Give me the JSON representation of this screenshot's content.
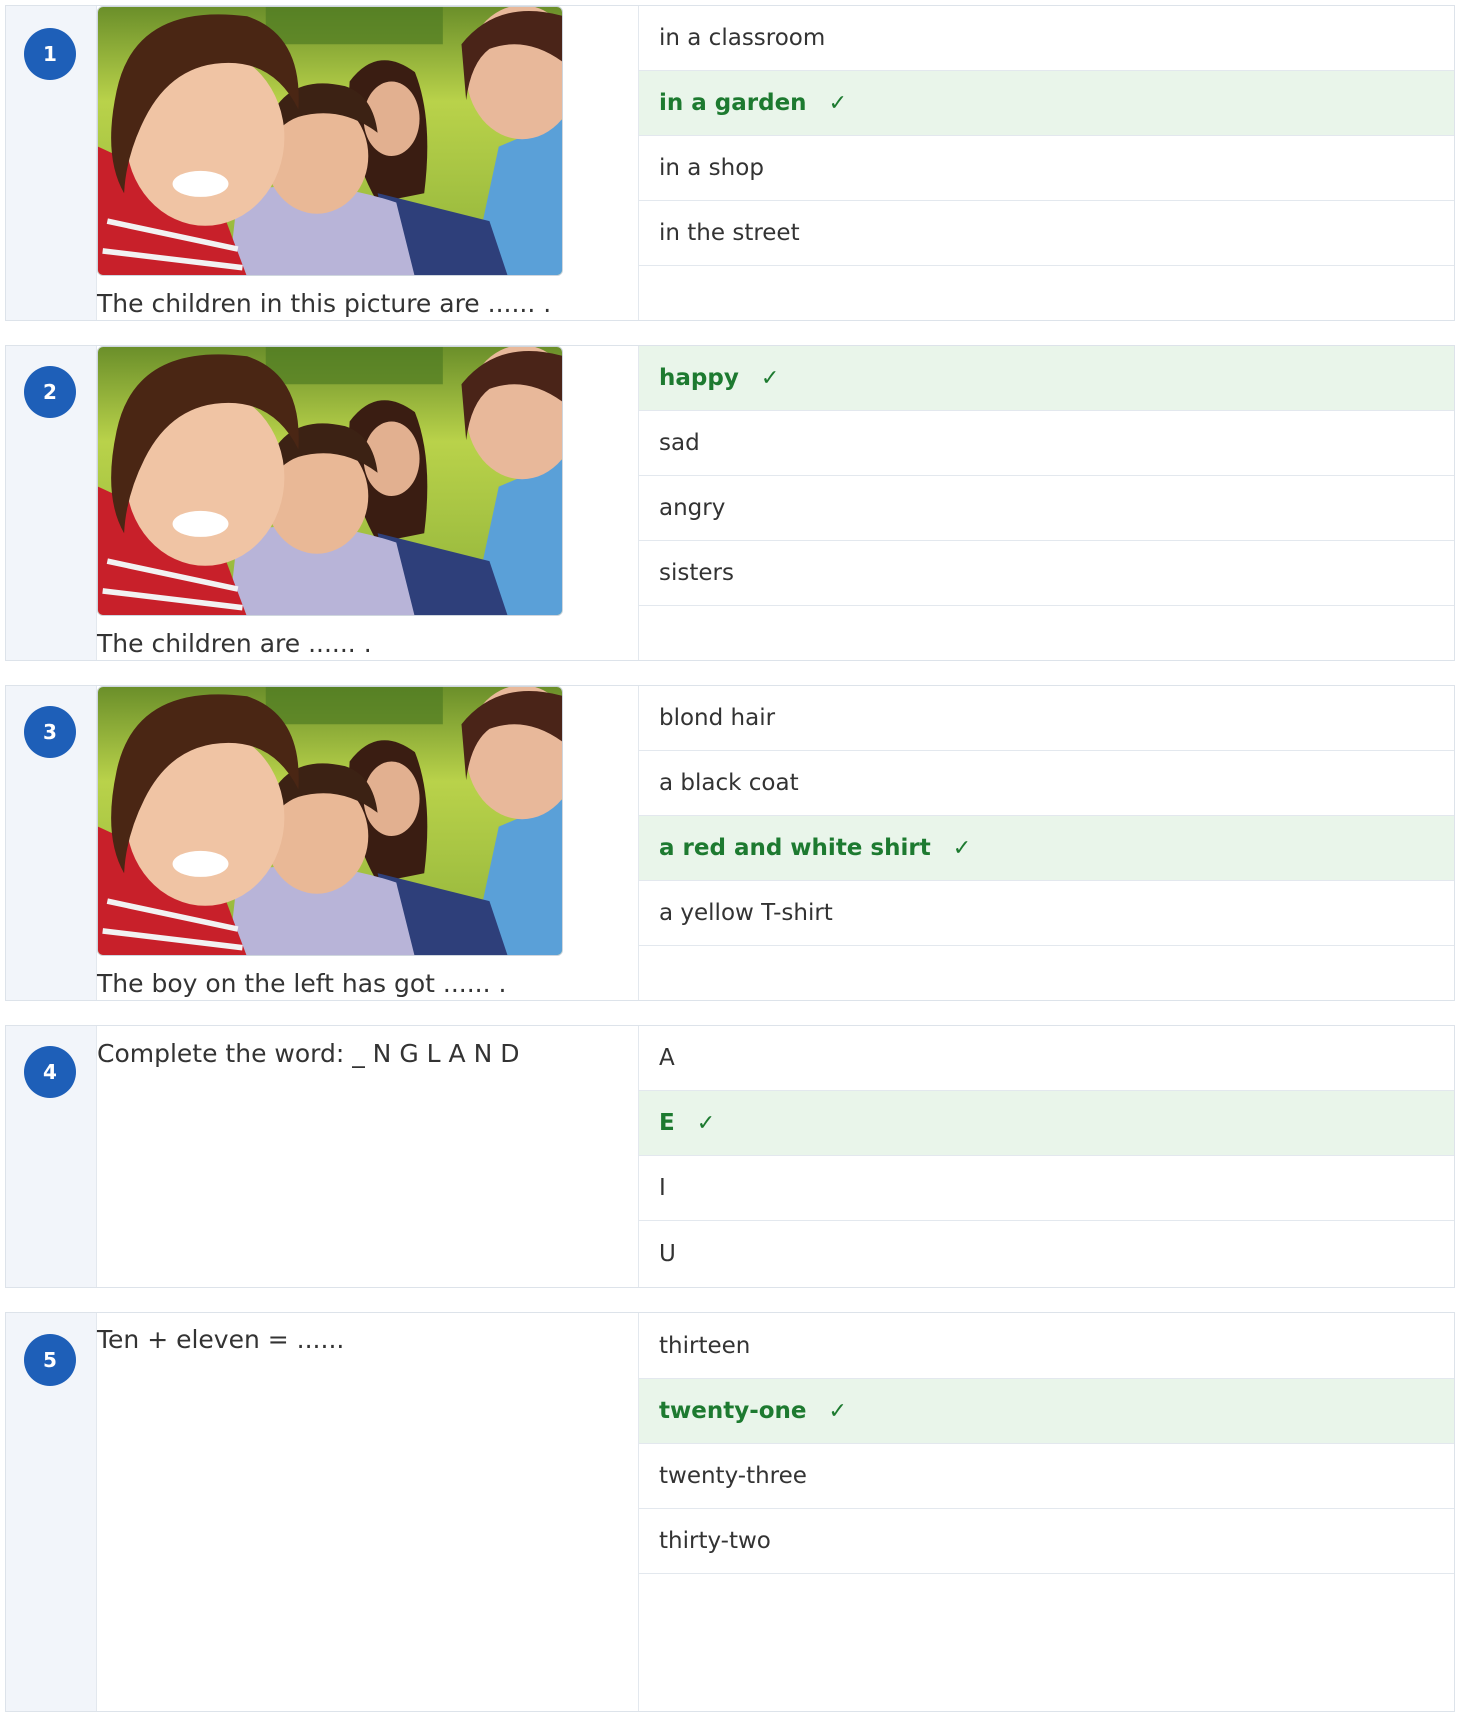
{
  "colors": {
    "badge": "#1e5fb8",
    "correct_bg": "#e9f5ea",
    "correct_text": "#1d7a30"
  },
  "check_mark": "✓",
  "questions": [
    {
      "number": "1",
      "image": "children-photo",
      "caption": "The children in this picture are ...... .",
      "options": [
        {
          "label": "in a classroom",
          "correct": false
        },
        {
          "label": "in a garden",
          "correct": true
        },
        {
          "label": "in a shop",
          "correct": false
        },
        {
          "label": "in the street",
          "correct": false
        }
      ]
    },
    {
      "number": "2",
      "image": "children-photo",
      "caption": "The children are ...... .",
      "options": [
        {
          "label": "happy",
          "correct": true
        },
        {
          "label": "sad",
          "correct": false
        },
        {
          "label": "angry",
          "correct": false
        },
        {
          "label": "sisters",
          "correct": false
        }
      ]
    },
    {
      "number": "3",
      "image": "children-photo",
      "caption": "The boy on the left has got ...... .",
      "options": [
        {
          "label": "blond hair",
          "correct": false
        },
        {
          "label": "a black coat",
          "correct": false
        },
        {
          "label": "a red and white shirt",
          "correct": true
        },
        {
          "label": "a yellow T-shirt",
          "correct": false
        }
      ]
    },
    {
      "number": "4",
      "text": "Complete the word: _ N G L A N D",
      "options": [
        {
          "label": "A",
          "correct": false
        },
        {
          "label": "E",
          "correct": true
        },
        {
          "label": "I",
          "correct": false
        },
        {
          "label": "U",
          "correct": false
        }
      ]
    },
    {
      "number": "5",
      "text": "Ten + eleven = ......",
      "options": [
        {
          "label": "thirteen",
          "correct": false
        },
        {
          "label": "twenty-one",
          "correct": true
        },
        {
          "label": "twenty-three",
          "correct": false
        },
        {
          "label": "thirty-two",
          "correct": false
        }
      ]
    }
  ]
}
